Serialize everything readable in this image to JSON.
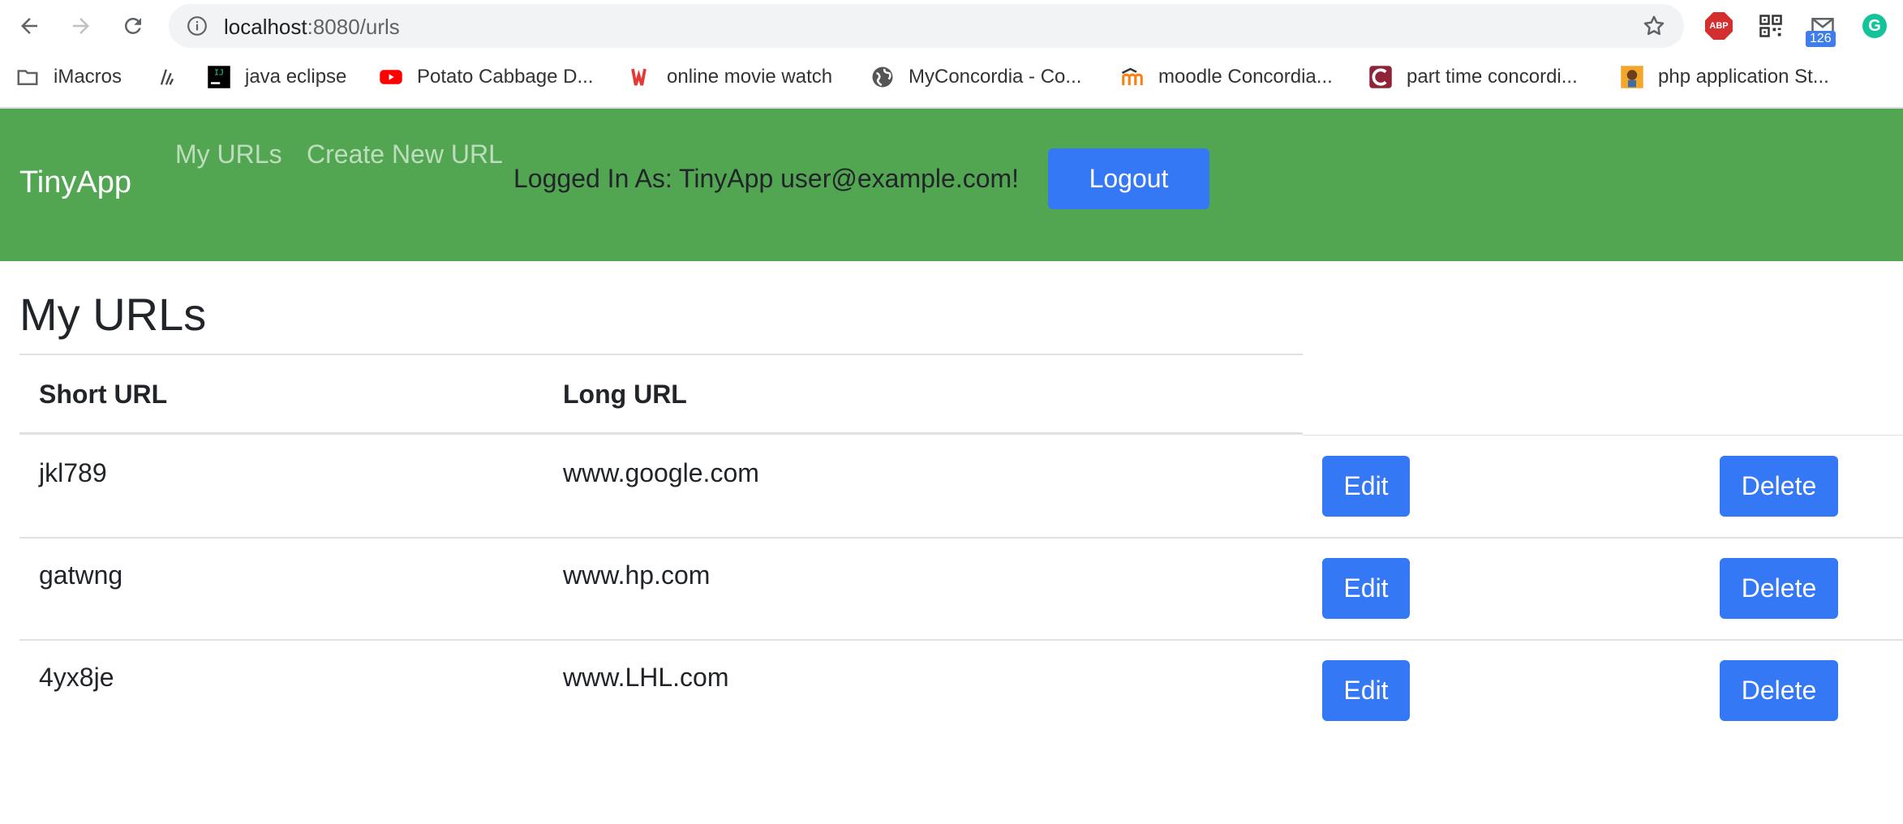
{
  "browser": {
    "url_host": "localhost",
    "url_path": ":8080/urls",
    "mail_count": "126",
    "abp_label": "ABP",
    "grammarly_label": "G",
    "bookmarks": [
      {
        "label": "iMacros",
        "icon": "folder-icon"
      },
      {
        "label": "",
        "icon": "bookmark-icon"
      },
      {
        "label": "java eclipse",
        "icon": "intellij-icon"
      },
      {
        "label": "Potato Cabbage D...",
        "icon": "youtube-icon"
      },
      {
        "label": "online movie watch",
        "icon": "movie-icon"
      },
      {
        "label": "MyConcordia - Co...",
        "icon": "globe-icon"
      },
      {
        "label": "moodle Concordia...",
        "icon": "moodle-icon"
      },
      {
        "label": "part time concordi...",
        "icon": "concordia-icon"
      },
      {
        "label": "php application St...",
        "icon": "php-icon"
      }
    ]
  },
  "navbar": {
    "brand": "TinyApp",
    "links": [
      "My URLs",
      "Create New URL"
    ],
    "logged_in_text": "Logged In As: TinyApp user@example.com!",
    "logout_label": "Logout",
    "bg_color": "#52a652"
  },
  "main": {
    "title": "My URLs",
    "columns": [
      "Short URL",
      "Long URL"
    ],
    "edit_label": "Edit",
    "delete_label": "Delete",
    "rows": [
      {
        "short": "jkl789",
        "long": "www.google.com"
      },
      {
        "short": "gatwng",
        "long": "www.hp.com"
      },
      {
        "short": "4yx8je",
        "long": "www.LHL.com"
      }
    ],
    "button_color": "#3478f6"
  }
}
